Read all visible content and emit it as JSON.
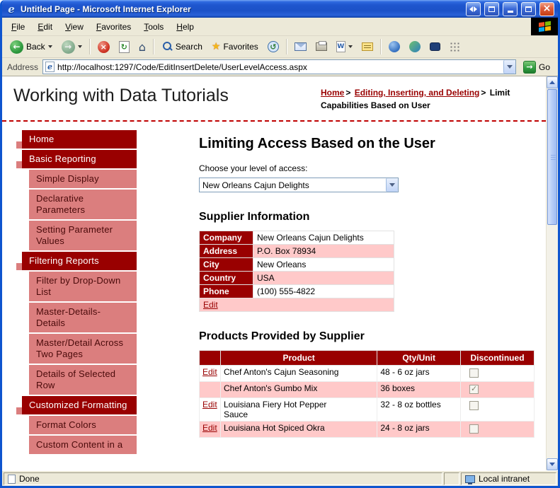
{
  "window": {
    "title": "Untitled Page - Microsoft Internet Explorer"
  },
  "menu": {
    "items": [
      "File",
      "Edit",
      "View",
      "Favorites",
      "Tools",
      "Help"
    ]
  },
  "toolbar": {
    "back": "Back",
    "search": "Search",
    "favorites": "Favorites",
    "go": "Go"
  },
  "icons": {
    "back_arrow": "←",
    "forward_arrow": "→",
    "stop_glyph": "×",
    "refresh_glyph": "↻",
    "home_glyph": "⌂",
    "star_glyph": "★",
    "history_glyph": "↺",
    "word_glyph": "W",
    "ie_glyph": "e",
    "go_arrow": "→",
    "close_glyph": "×"
  },
  "address": {
    "label": "Address",
    "url": "http://localhost:1297/Code/EditInsertDelete/UserLevelAccess.aspx"
  },
  "header": {
    "site_title": "Working with Data Tutorials",
    "breadcrumb": {
      "home": "Home",
      "section": "Editing, Inserting, and Deleting",
      "sep": ">",
      "current": "Limit Capabilities Based on User"
    }
  },
  "sidebar": {
    "items": [
      {
        "label": "Home",
        "type": "section"
      },
      {
        "label": "Basic Reporting",
        "type": "section"
      },
      {
        "label": "Simple Display",
        "type": "sub"
      },
      {
        "label": "Declarative Parameters",
        "type": "sub"
      },
      {
        "label": "Setting Parameter Values",
        "type": "sub"
      },
      {
        "label": "Filtering Reports",
        "type": "section"
      },
      {
        "label": "Filter by Drop-Down List",
        "type": "sub"
      },
      {
        "label": "Master-Details-Details",
        "type": "sub"
      },
      {
        "label": "Master/Detail Across Two Pages",
        "type": "sub"
      },
      {
        "label": "Details of Selected Row",
        "type": "sub"
      },
      {
        "label": "Customized Formatting",
        "type": "section"
      },
      {
        "label": "Format Colors",
        "type": "sub"
      },
      {
        "label": "Custom Content in a",
        "type": "sub"
      }
    ]
  },
  "main": {
    "title": "Limiting Access Based on the User",
    "access_label": "Choose your level of access:",
    "access_value": "New Orleans Cajun Delights",
    "supplier": {
      "heading": "Supplier Information",
      "rows": [
        [
          "Company",
          "New Orleans Cajun Delights"
        ],
        [
          "Address",
          "P.O. Box 78934"
        ],
        [
          "City",
          "New Orleans"
        ],
        [
          "Country",
          "USA"
        ],
        [
          "Phone",
          "(100) 555-4822"
        ]
      ],
      "edit": "Edit"
    },
    "products": {
      "heading": "Products Provided by Supplier",
      "columns": {
        "product": "Product",
        "qty": "Qty/Unit",
        "discontinued": "Discontinued"
      },
      "rows": [
        {
          "edit": "Edit",
          "product": "Chef Anton's Cajun Seasoning",
          "qty": "48 - 6 oz jars",
          "discontinued": false
        },
        {
          "edit": "",
          "product": "Chef Anton's Gumbo Mix",
          "qty": "36 boxes",
          "discontinued": true
        },
        {
          "edit": "Edit",
          "product": "Louisiana Fiery Hot Pepper Sauce",
          "qty": "32 - 8 oz bottles",
          "discontinued": false
        },
        {
          "edit": "Edit",
          "product": "Louisiana Hot Spiced Okra",
          "qty": "24 - 8 oz jars",
          "discontinued": false
        }
      ]
    }
  },
  "status": {
    "left": "Done",
    "right": "Local intranet"
  },
  "colors": {
    "accent": "#990000",
    "alt_row": "#FFC9C9",
    "subitem_bg": "#DB7E7E"
  }
}
